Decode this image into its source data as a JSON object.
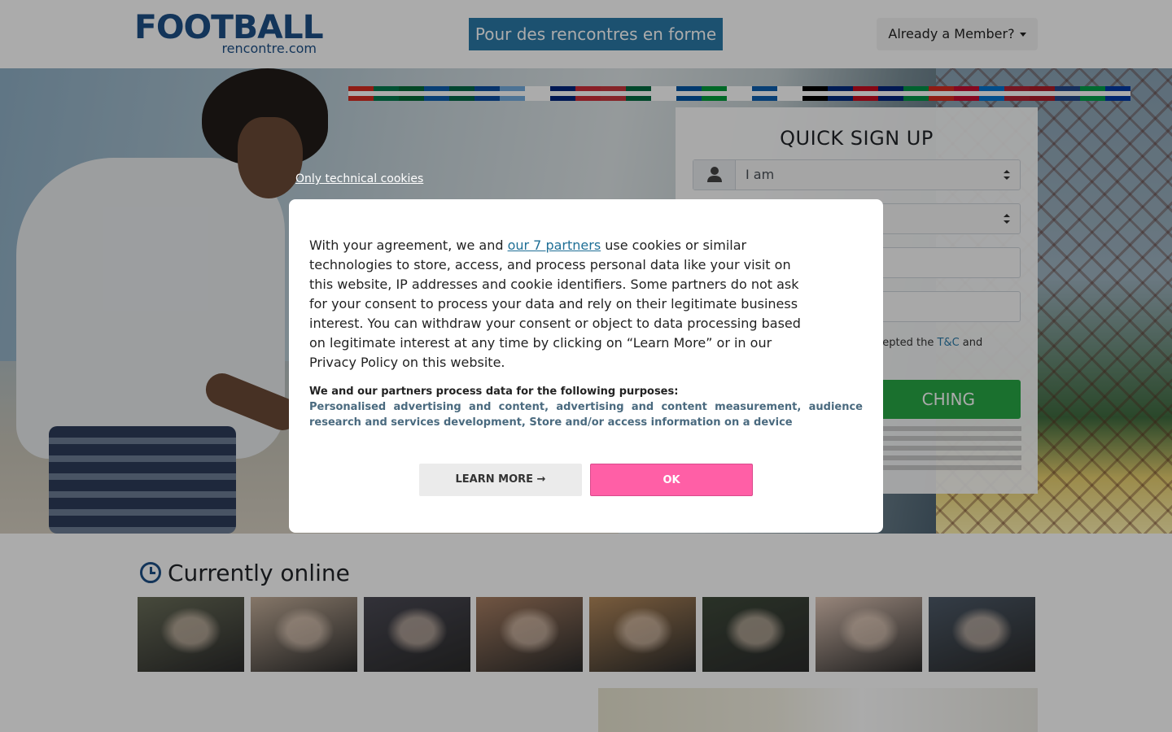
{
  "header": {
    "logo_main": "FOOTBALL",
    "logo_sub": "rencontre.com",
    "tagline": "Pour des rencontres en forme",
    "member_label": "Already a Member?"
  },
  "signup": {
    "title": "QUICK SIGN UP",
    "gender_value": "I am",
    "terms_prefix": "ccepted the",
    "terms_link": "T&C",
    "terms_suffix": "and",
    "start_label": "CHING"
  },
  "online": {
    "title": "Currently online",
    "photo_colors": [
      "#6b6f5a",
      "#c7b19c",
      "#4b4a55",
      "#a98064",
      "#b58a5c",
      "#3f4a3b",
      "#e2c8b8",
      "#4e5b6a"
    ]
  },
  "flags": {
    "colors": [
      "#d52b1e",
      "#007a4d",
      "#046a38",
      "#0d5eaf",
      "#006847",
      "#0b4ea2",
      "#74acdf",
      "#ffffff",
      "#00247d",
      "#cd2e3a",
      "#c6363c",
      "#006b3f",
      "#ffffff",
      "#0055a4",
      "#009c3b",
      "#ffffff",
      "#0d5eaf",
      "#ffffff",
      "#000000",
      "#002b7f",
      "#c60b1e",
      "#00247d",
      "#009246",
      "#d52b1e",
      "#c60c30",
      "#0073cf",
      "#b22234",
      "#ae1c28",
      "#21468b",
      "#009e49",
      "#0039a6"
    ]
  },
  "cookies": {
    "technical_link": "Only technical cookies",
    "intro_before": "With your agreement, we and ",
    "partners_link": "our 7 partners",
    "intro_after": " use cookies or similar technologies to store, access, and process personal data like your visit on this website, IP addresses and cookie identifiers. Some partners do not ask for your consent to process your data and rely on their legitimate business interest. You can withdraw your consent or object to data processing based on legitimate interest at any time by clicking on “Learn More” or in our Privacy Policy on this website.",
    "purposes_title": "We and our partners process data for the following purposes:",
    "purposes_list": "Personalised advertising and content, advertising and content measurement, audience research and services development, Store and/or access information on a device",
    "learn_more": "LEARN MORE →",
    "ok": "OK"
  },
  "colors": {
    "brand_blue": "#1d4f86",
    "tagline_bg": "#2a7aa8",
    "start_green": "#28a745",
    "ok_pink": "#ff5fa6"
  }
}
